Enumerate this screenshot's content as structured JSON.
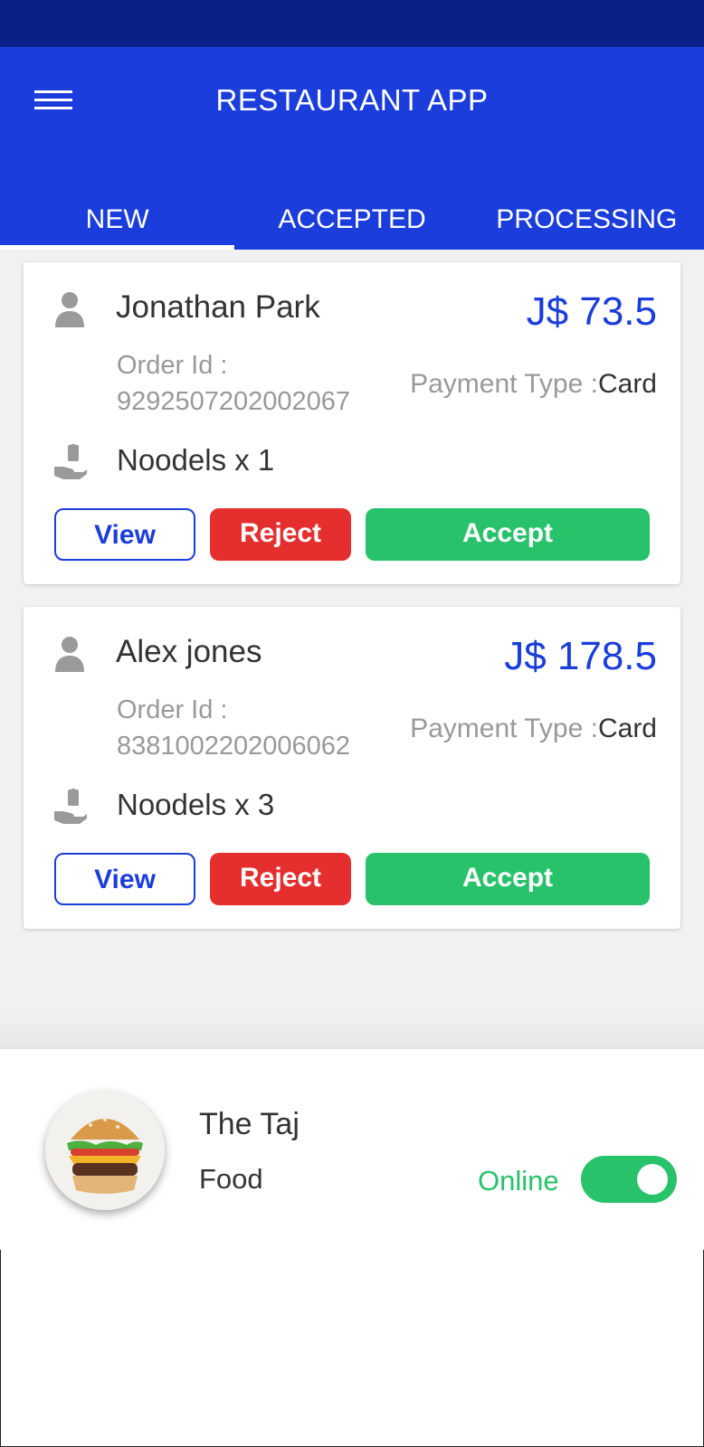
{
  "app": {
    "title": "RESTAURANT APP"
  },
  "tabs": [
    {
      "label": "NEW",
      "active": true
    },
    {
      "label": "ACCEPTED",
      "active": false
    },
    {
      "label": "PROCESSING",
      "active": false
    }
  ],
  "orders": [
    {
      "customer": "Jonathan Park",
      "total": "J$ 73.5",
      "order_id_label": "Order Id :",
      "order_id": "9292507202002067",
      "payment_label": "Payment Type :",
      "payment_value": "Card",
      "item": "Noodels x 1",
      "view_label": "View",
      "reject_label": "Reject",
      "accept_label": "Accept"
    },
    {
      "customer": "Alex jones",
      "total": "J$ 178.5",
      "order_id_label": "Order Id :",
      "order_id": "8381002202006062",
      "payment_label": "Payment Type :",
      "payment_value": "Card",
      "item": "Noodels x 3",
      "view_label": "View",
      "reject_label": "Reject",
      "accept_label": "Accept"
    }
  ],
  "restaurant": {
    "name": "The Taj",
    "type": "Food",
    "status_label": "Online",
    "online": true
  },
  "icons": {
    "menu": "hamburger-menu-icon",
    "person": "person-icon",
    "item": "hand-holding-bag-icon",
    "avatar": "burger-image"
  },
  "colors": {
    "status_bar": "#0a1f88",
    "primary": "#1a3ddb",
    "reject": "#e52e2e",
    "accept": "#27c26a",
    "online": "#27c26a"
  }
}
